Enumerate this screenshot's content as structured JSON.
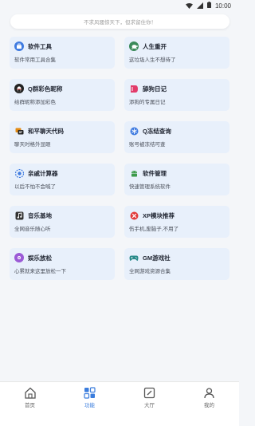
{
  "status_bar": {
    "time": "10:00"
  },
  "search": {
    "placeholder": "不求风骚惊天下，但求留住你！"
  },
  "cards": [
    {
      "title": "软件工具",
      "subtitle": "软件常用工具合集",
      "icon": "toolbox-icon",
      "color": "#3f7be0"
    },
    {
      "title": "人生重开",
      "subtitle": "这垃圾人生不想待了",
      "icon": "turtle-icon",
      "color": "#3b8a5a"
    },
    {
      "title": "Q群彩色昵称",
      "subtitle": "给群昵称添加彩色",
      "icon": "qq-penguin-icon",
      "color": "#222222"
    },
    {
      "title": "舔狗日记",
      "subtitle": "添狗的专属日记",
      "icon": "diary-icon",
      "color": "#e23b6a"
    },
    {
      "title": "和平聊天代码",
      "subtitle": "聊天时格外显眼",
      "icon": "chat-code-icon",
      "color": "#e38a12"
    },
    {
      "title": "Q冻结查询",
      "subtitle": "账号被冻结可查",
      "icon": "freeze-icon",
      "color": "#3f7be0"
    },
    {
      "title": "亲戚计算器",
      "subtitle": "以后不怕不会喊了",
      "icon": "relation-calc-icon",
      "color": "#3f7be0"
    },
    {
      "title": "软件管理",
      "subtitle": "快速管理系统软件",
      "icon": "android-icon",
      "color": "#3b9a4a"
    },
    {
      "title": "音乐基地",
      "subtitle": "全网音乐随心听",
      "icon": "music-icon",
      "color": "#333333"
    },
    {
      "title": "XP模块推荐",
      "subtitle": "伤手机,废脑子,不用了",
      "icon": "xp-module-icon",
      "color": "#e23b3b"
    },
    {
      "title": "娱乐放松",
      "subtitle": "心累就来这里放松一下",
      "icon": "relax-icon",
      "color": "#9b5ad6"
    },
    {
      "title": "GM游戏社",
      "subtitle": "全网游戏资源合集",
      "icon": "gamepad-icon",
      "color": "#2a8a8a"
    }
  ],
  "tabs": [
    {
      "label": "首页",
      "icon": "home-icon",
      "active": false
    },
    {
      "label": "功能",
      "icon": "grid-icon",
      "active": true
    },
    {
      "label": "大厅",
      "icon": "hall-icon",
      "active": false
    },
    {
      "label": "我的",
      "icon": "profile-icon",
      "active": false
    }
  ],
  "colors": {
    "accent": "#3b7ddd",
    "card_bg": "#e8f0fb",
    "page_bg": "#f4f6f9"
  }
}
